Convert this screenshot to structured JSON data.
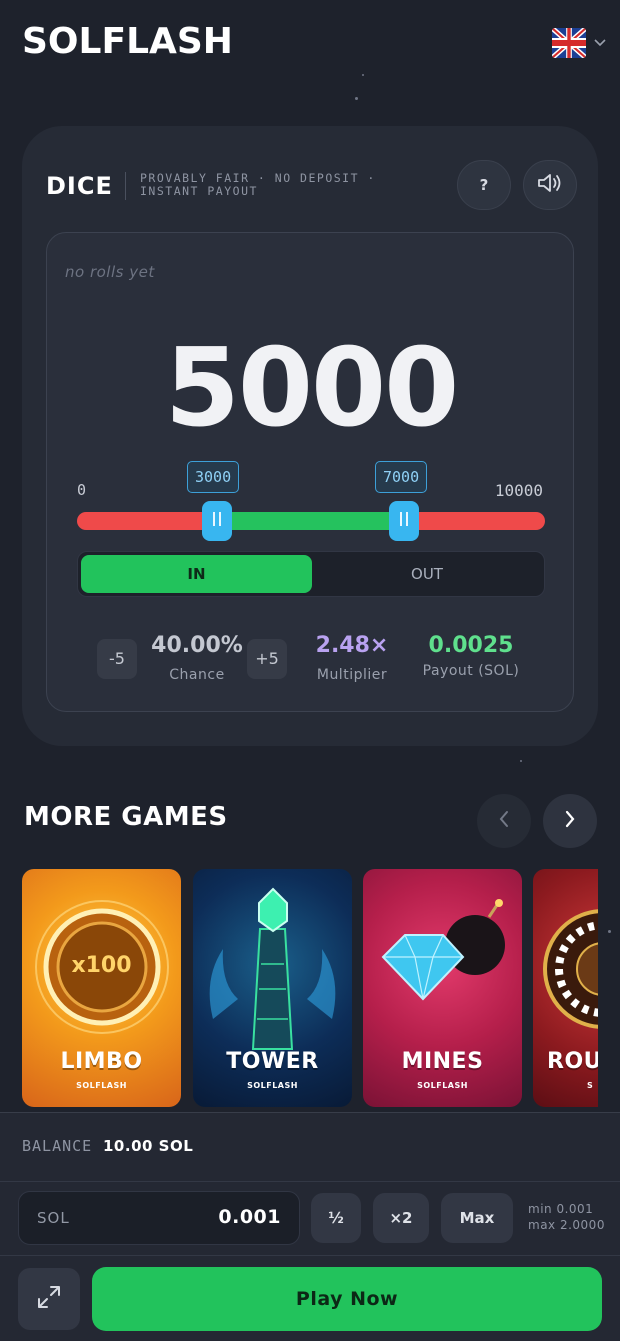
{
  "header": {
    "logo": "SOLFLASH",
    "language": "English (UK)"
  },
  "dice": {
    "title": "DICE",
    "tagline": "PROVABLY FAIR · NO DEPOSIT · INSTANT PAYOUT",
    "help_label": "?",
    "no_rolls_text": "no rolls yet",
    "result": "5000",
    "range_min": "0",
    "range_max": "10000",
    "low_value": "3000",
    "high_value": "7000",
    "slider": {
      "min": 0,
      "max": 10000,
      "low": 3000,
      "high": 7000
    },
    "mode": {
      "in_label": "IN",
      "out_label": "OUT",
      "selected": "IN"
    },
    "stats": {
      "minus_label": "-5",
      "plus_label": "+5",
      "chance_value": "40.00%",
      "chance_label": "Chance",
      "multiplier_value": "2.48×",
      "multiplier_label": "Multiplier",
      "payout_value": "0.0025",
      "payout_label": "Payout (SOL)"
    }
  },
  "more_games": {
    "title": "MORE GAMES",
    "games": [
      {
        "name": "LIMBO",
        "brand": "SOLFLASH",
        "badge": "x100"
      },
      {
        "name": "TOWER",
        "brand": "SOLFLASH"
      },
      {
        "name": "MINES",
        "brand": "SOLFLASH"
      },
      {
        "name": "ROU",
        "brand": "S"
      }
    ]
  },
  "bottom": {
    "balance_label": "BALANCE",
    "balance_value": "10.00 SOL",
    "bet_currency": "SOL",
    "bet_value": "0.001",
    "half_label": "½",
    "double_label": "×2",
    "max_label": "Max",
    "min_label": "min 0.001",
    "max_limit_label": "max 2.0000",
    "play_label": "Play Now"
  },
  "colors": {
    "background": "#1e222c",
    "accent_green": "#22c35c",
    "accent_red": "#ef4a4a",
    "accent_blue": "#38b6f0",
    "multiplier_purple": "#b9a2f0"
  }
}
